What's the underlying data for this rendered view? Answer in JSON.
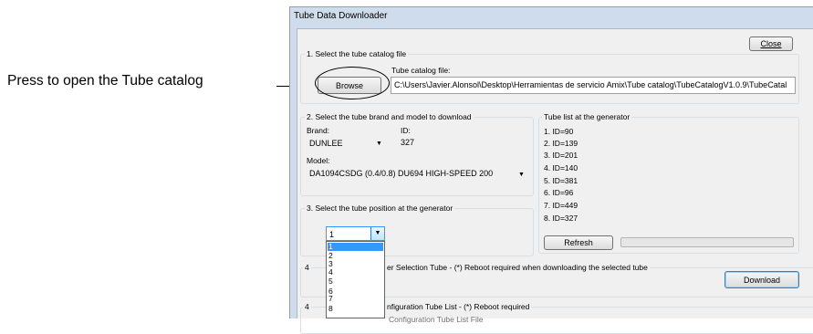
{
  "callout": {
    "text": "Press to open the Tube catalog"
  },
  "window": {
    "title": "Tube Data Downloader"
  },
  "close_button": {
    "label": "Close"
  },
  "section1": {
    "legend": "1. Select the tube catalog file",
    "browse_label": "Browse",
    "file_label": "Tube catalog file:",
    "file_path": "C:\\Users\\Javier.Alonsol\\Desktop\\Herramientas de servicio Amix\\Tube catalog\\TubeCatalogV1.0.9\\TubeCatal"
  },
  "section2": {
    "legend": "2. Select the tube brand and model to download",
    "brand_label": "Brand:",
    "brand_value": "DUNLEE",
    "id_label": "ID:",
    "id_value": "327",
    "model_label": "Model:",
    "model_value": "DA1094CSDG (0.4/0.8) DU694 HIGH-SPEED 200"
  },
  "tube_list": {
    "legend": "Tube list at the generator",
    "items": [
      "1. ID=90",
      "2. ID=139",
      "3. ID=201",
      "4. ID=140",
      "5. ID=381",
      "6. ID=96",
      "7. ID=449",
      "8. ID=327"
    ],
    "refresh_label": "Refresh",
    "progress": 0
  },
  "section3": {
    "legend": "3. Select the tube position at the generator",
    "position_value": "1",
    "options": [
      "1",
      "2",
      "3",
      "4",
      "5",
      "6",
      "7",
      "8"
    ],
    "selected_index": 0
  },
  "section4": {
    "legend_prefix": "4",
    "legend": "er Selection Tube  -  (*) Reboot required when downloading the selected tube",
    "download_label": "Download"
  },
  "section5": {
    "legend_prefix": "4",
    "legend": "nfiguration Tube List - (*) Reboot required",
    "partial_text": "Configuration Tube List File"
  }
}
